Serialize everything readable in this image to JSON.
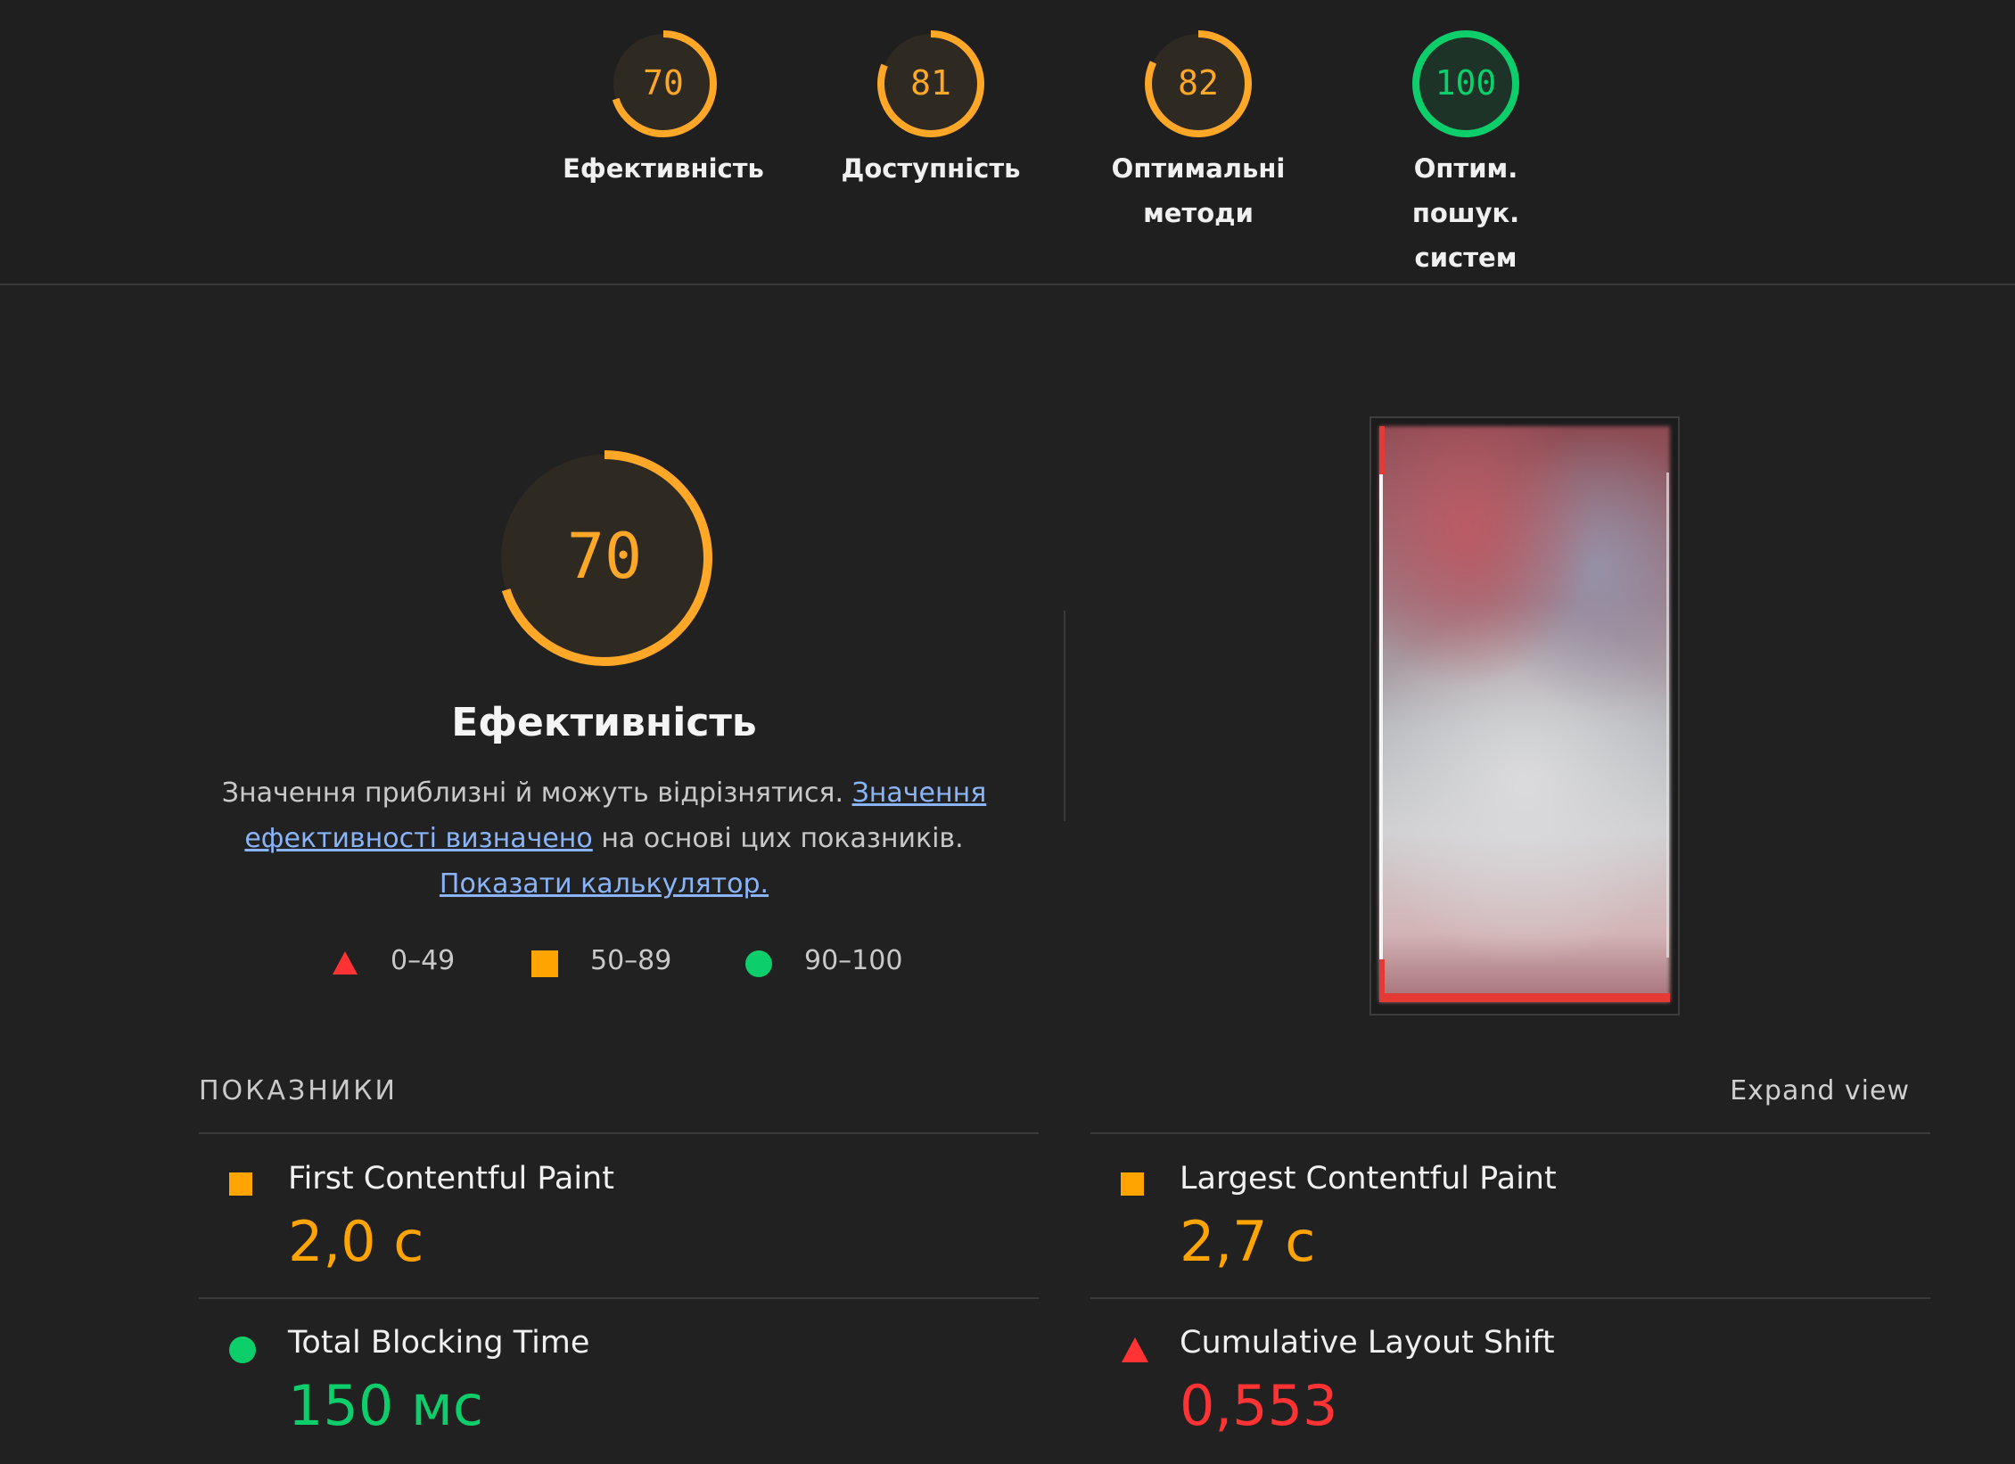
{
  "categories": [
    {
      "score": 70,
      "label": "Ефективність",
      "color": "#ffa726",
      "fraction": 0.7
    },
    {
      "score": 81,
      "label": "Доступність",
      "color": "#ffa726",
      "fraction": 0.81
    },
    {
      "score": 82,
      "label": "Оптимальні методи",
      "color": "#ffa726",
      "fraction": 0.82
    },
    {
      "score": 100,
      "label": "Оптим. пошук. систем",
      "color": "#0cce6b",
      "fraction": 1.0
    }
  ],
  "performance": {
    "score": 70,
    "fraction": 0.7,
    "title": "Ефективність",
    "desc_text_1": "Значення приблизні й можуть відрізнятися.",
    "desc_link_1": "Значення ефективності визначено",
    "desc_text_2": "на основі цих показників.",
    "desc_link_2": "Показати калькулятор."
  },
  "legend": [
    {
      "range": "0–49",
      "shape": "triangle",
      "color": "#ff3333"
    },
    {
      "range": "50–89",
      "shape": "square",
      "color": "#ffa400"
    },
    {
      "range": "90–100",
      "shape": "circle",
      "color": "#0cce6b"
    }
  ],
  "metrics_header": "ПОКАЗНИКИ",
  "expand_label": "Expand view",
  "metrics": [
    {
      "name": "First Contentful Paint",
      "value": "2,0 с",
      "status": "average",
      "color": "#ffa400"
    },
    {
      "name": "Largest Contentful Paint",
      "value": "2,7 с",
      "status": "average",
      "color": "#ffa400"
    },
    {
      "name": "Total Blocking Time",
      "value": "150 мс",
      "status": "pass",
      "color": "#0cce6b"
    },
    {
      "name": "Cumulative Layout Shift",
      "value": "0,553",
      "status": "fail",
      "color": "#ff3333"
    }
  ]
}
